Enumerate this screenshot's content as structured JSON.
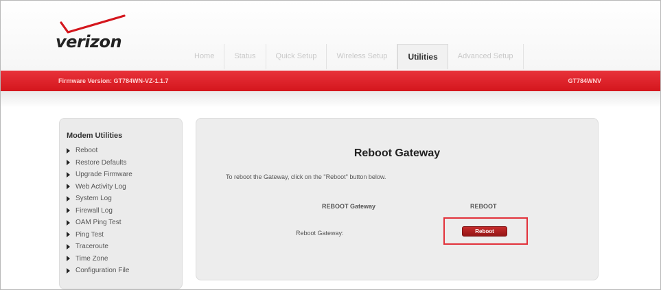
{
  "brand": {
    "logo_text": "verizon",
    "accent_color": "#d4161d"
  },
  "nav": {
    "tabs": [
      {
        "label": "Home",
        "active": false
      },
      {
        "label": "Status",
        "active": false
      },
      {
        "label": "Quick Setup",
        "active": false
      },
      {
        "label": "Wireless Setup",
        "active": false
      },
      {
        "label": "Utilities",
        "active": true
      },
      {
        "label": "Advanced Setup",
        "active": false
      }
    ]
  },
  "status_bar": {
    "firmware": "Firmware Version: GT784WN-VZ-1.1.7",
    "model": "GT784WNV"
  },
  "sidebar": {
    "title": "Modem Utilities",
    "items": [
      {
        "label": "Reboot"
      },
      {
        "label": "Restore Defaults"
      },
      {
        "label": "Upgrade Firmware"
      },
      {
        "label": "Web Activity Log"
      },
      {
        "label": "System Log"
      },
      {
        "label": "Firewall Log"
      },
      {
        "label": "OAM Ping Test"
      },
      {
        "label": "Ping Test"
      },
      {
        "label": "Traceroute"
      },
      {
        "label": "Time Zone"
      },
      {
        "label": "Configuration File"
      }
    ]
  },
  "main": {
    "title": "Reboot Gateway",
    "description": "To reboot the Gateway, click on the \"Reboot\" button below.",
    "table": {
      "headers": [
        "REBOOT Gateway",
        "REBOOT"
      ],
      "row_label": "Reboot Gateway:",
      "button_label": "Reboot"
    }
  }
}
